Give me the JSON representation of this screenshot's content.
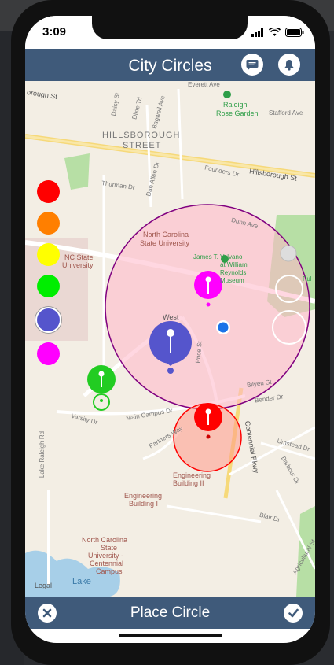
{
  "status": {
    "time": "3:09"
  },
  "header": {
    "title": "City Circles",
    "chat_icon": "chat-bubble-icon",
    "bell_icon": "bell-icon"
  },
  "map": {
    "labels": {
      "hillsborough": "HILLSBOROUGH",
      "street": "STREET",
      "raleigh": "Raleigh",
      "rose_garden": "Rose Garden",
      "ncsu1": "North Carolina",
      "ncsu2": "State University",
      "ncsu_short1": "NC State",
      "ncsu_short2": "University",
      "valvano1": "James T. Valvano",
      "valvano2": "at William",
      "valvano3": "Reynolds",
      "valvano4": "Museum",
      "eng2_1": "Engineering",
      "eng2_2": "Building II",
      "eng1_1": "Engineering",
      "eng1_2": "Building I",
      "centennial1": "North Carolina",
      "centennial2": "State",
      "centennial3": "University -",
      "centennial4": "Centennial",
      "centennial5": "Campus",
      "hillsborough_st": "Hillsborough St",
      "borough_st": "orough St",
      "everett": "Everett Ave",
      "stafford": "Stafford Ave",
      "founders": "Founders Dr",
      "thurman": "Thurman Dr",
      "dunn": "Dunn Ave",
      "bilyeu": "Bilyeu St",
      "bender": "Bender Dr",
      "varsity": "Varsity Dr",
      "main_campus": "Main Campus Dr",
      "partners": "Partners Way",
      "centennial_pkwy": "Centennial Pkwy",
      "umstead": "Umstead Dr",
      "barbour": "Barbour Dr",
      "blair": "Blair Dr",
      "lake_raleigh_rd": "Lake Raleigh Rd",
      "lake": "Lake",
      "legal": "Legal",
      "dan_allen": "Dan Allen Dr",
      "dixie": "Dixie Trl",
      "daisy": "Daisy St",
      "bagwell": "Bagwell Ave",
      "west": "West",
      "price": "Price St",
      "agricultural": "Agricultural St",
      "pul": "Pul"
    }
  },
  "palette": {
    "colors": [
      "#ff0000",
      "#ff7f00",
      "#ffff00",
      "#00ee00",
      "#5555cc",
      "#ff00ff"
    ],
    "selected_index": 4
  },
  "bottom": {
    "title": "Place Circle",
    "cancel_icon": "close-icon",
    "confirm_icon": "checkmark-icon"
  }
}
